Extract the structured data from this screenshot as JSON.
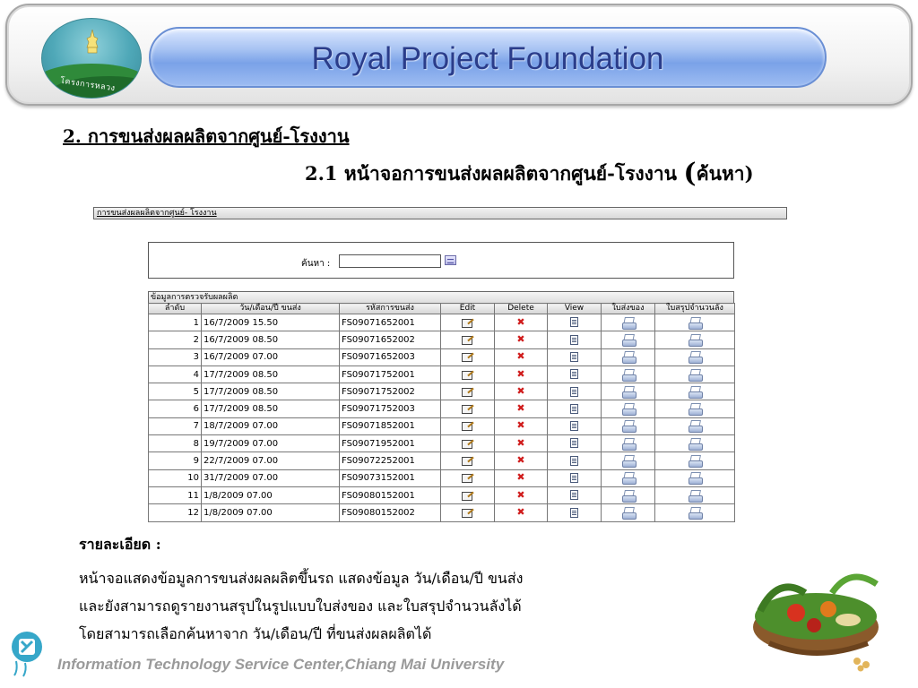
{
  "header": {
    "logo_text": "โครงการหลวง",
    "banner_title": "Royal Project Foundation"
  },
  "headings": {
    "section": "2. การขนส่งผลผลิตจากศูนย์-โรงงาน",
    "subsection_main": "2.1 หน้าจอการขนส่งผลผลิตจากศูนย์-โรงงาน",
    "subsection_paren_open": "(",
    "subsection_paren_text": "ค้นหา",
    "subsection_paren_close": ")"
  },
  "app": {
    "window_title": "การขนส่งผลผลิตจากศูนย์- โรงงาน",
    "search": {
      "label": "ค้นหา :",
      "value": "",
      "placeholder": ""
    },
    "grid": {
      "caption": "ข้อมูลการตรวจรับผลผลิต",
      "columns": [
        "ลำดับ",
        "วัน/เดือน/ปี ขนส่ง",
        "รหัสการขนส่ง",
        "Edit",
        "Delete",
        "View",
        "ใบส่งของ",
        "ใบสรุปจำนวนลัง"
      ],
      "rows": [
        {
          "no": "1",
          "date": "16/7/2009 15.50",
          "code": "FS09071652001"
        },
        {
          "no": "2",
          "date": "16/7/2009 08.50",
          "code": "FS09071652002"
        },
        {
          "no": "3",
          "date": "16/7/2009 07.00",
          "code": "FS09071652003"
        },
        {
          "no": "4",
          "date": "17/7/2009 08.50",
          "code": "FS09071752001"
        },
        {
          "no": "5",
          "date": "17/7/2009 08.50",
          "code": "FS09071752002"
        },
        {
          "no": "6",
          "date": "17/7/2009 08.50",
          "code": "FS09071752003"
        },
        {
          "no": "7",
          "date": "18/7/2009 07.00",
          "code": "FS09071852001"
        },
        {
          "no": "8",
          "date": "19/7/2009 07.00",
          "code": "FS09071952001"
        },
        {
          "no": "9",
          "date": "22/7/2009 07.00",
          "code": "FS09072252001"
        },
        {
          "no": "10",
          "date": "31/7/2009 07.00",
          "code": "FS09073152001"
        },
        {
          "no": "11",
          "date": "1/8/2009 07.00",
          "code": "FS09080152001"
        },
        {
          "no": "12",
          "date": "1/8/2009 07.00",
          "code": "FS09080152002"
        }
      ],
      "icons": {
        "edit": "edit-icon",
        "delete": "delete-icon",
        "view": "view-icon",
        "delivery_note": "printer-icon",
        "box_summary": "printer-icon"
      }
    }
  },
  "description": {
    "title": "รายละเอียด :",
    "lines": [
      "หน้าจอแสดงข้อมูลการขนส่งผลผลิตขึ้นรถ แสดงข้อมูล วัน/เดือน/ปี ขนส่ง",
      "และยังสามารถดูรายงานสรุปในรูปแบบใบส่งของ และใบสรุปจำนวนลังได้",
      "โดยสามารถเลือกค้นหาจาก วัน/เดือน/ปี ที่ขนส่งผลผลิตได้"
    ]
  },
  "footer": {
    "text": "Information Technology Service Center,Chiang Mai University"
  },
  "colors": {
    "banner_text": "#2a3c8a",
    "delete_icon": "#d01c1c",
    "footer_text": "#9a9a9a"
  }
}
